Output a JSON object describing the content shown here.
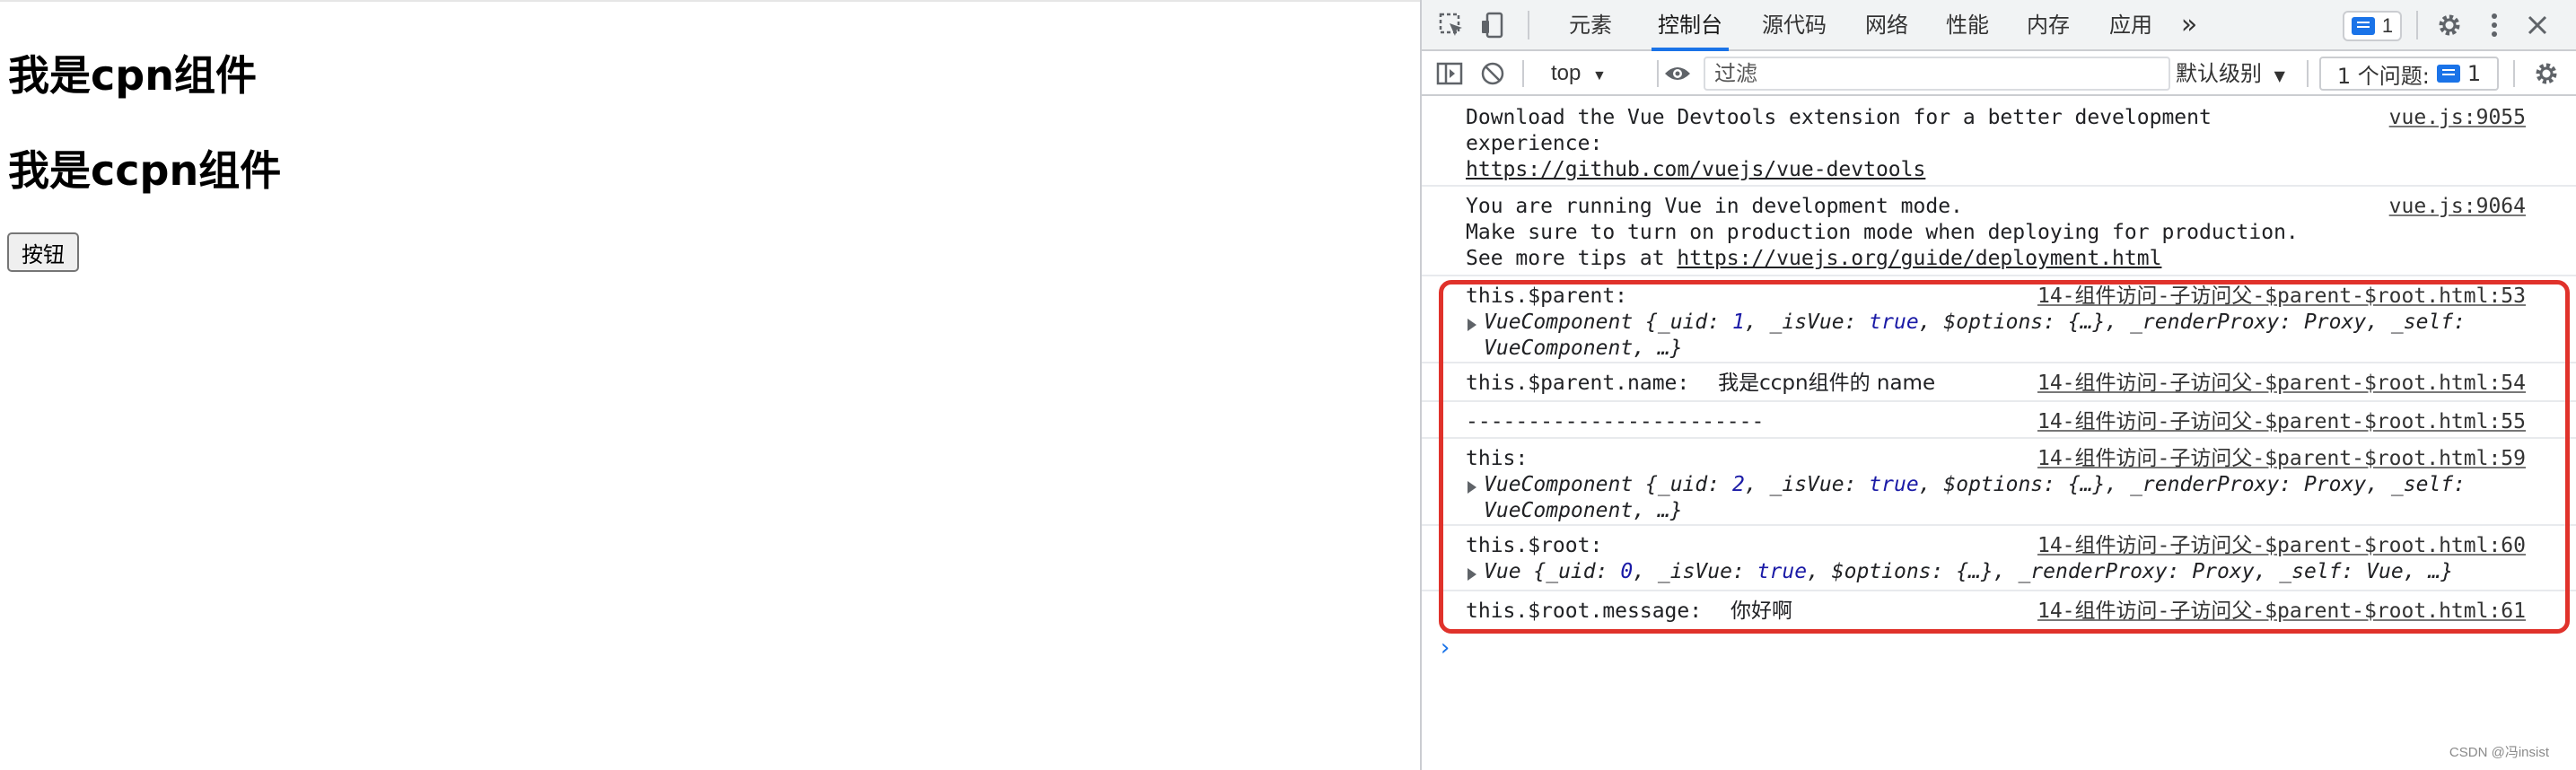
{
  "page": {
    "heading_cpn": "我是cpn组件",
    "heading_ccpn": "我是ccpn组件",
    "button_label": "按钮"
  },
  "devtools": {
    "tabs": [
      "元素",
      "控制台",
      "源代码",
      "网络",
      "性能",
      "内存",
      "应用"
    ],
    "active_tab": "控制台",
    "more_tabs": "»",
    "issue_count": "1",
    "context": "top",
    "filter_placeholder": "过滤",
    "level_label": "默认级别",
    "issues_label": "1 个问题:",
    "issues_count": "1",
    "colors": {
      "accent": "#1a73e8",
      "highlight": "#e0322b"
    }
  },
  "console": {
    "m1": {
      "text": "Download the Vue Devtools extension for a better development experience:",
      "link": "https://github.com/vuejs/vue-devtools",
      "source": "vue.js:9055"
    },
    "m2": {
      "line1": "You are running Vue in development mode.",
      "line2": "Make sure to turn on production mode when deploying for production.",
      "line3_prefix": "See more tips at ",
      "link": "https://vuejs.org/guide/deployment.html",
      "source": "vue.js:9064"
    },
    "m3": {
      "label": "this.$parent:",
      "object": "VueComponent {_uid: 1, _isVue: true, $options: {…}, _renderProxy: Proxy, _self: VueComponent, …}",
      "source": "14-组件访问-子访问父-$parent-$root.html:53"
    },
    "m4": {
      "label": "this.$parent.name:",
      "value": "我是ccpn组件的 name",
      "source": "14-组件访问-子访问父-$parent-$root.html:54"
    },
    "m5": {
      "text": "------------------------",
      "source": "14-组件访问-子访问父-$parent-$root.html:55"
    },
    "m6": {
      "label": "this:",
      "object": "VueComponent {_uid: 2, _isVue: true, $options: {…}, _renderProxy: Proxy, _self: VueComponent, …}",
      "source": "14-组件访问-子访问父-$parent-$root.html:59"
    },
    "m7": {
      "label": "this.$root:",
      "object": "Vue {_uid: 0, _isVue: true, $options: {…}, _renderProxy: Proxy, _self: Vue, …}",
      "source": "14-组件访问-子访问父-$parent-$root.html:60"
    },
    "m8": {
      "label": "this.$root.message:",
      "value": "你好啊",
      "source": "14-组件访问-子访问父-$parent-$root.html:61"
    },
    "prompt": "›"
  },
  "watermark": "CSDN @冯insist"
}
